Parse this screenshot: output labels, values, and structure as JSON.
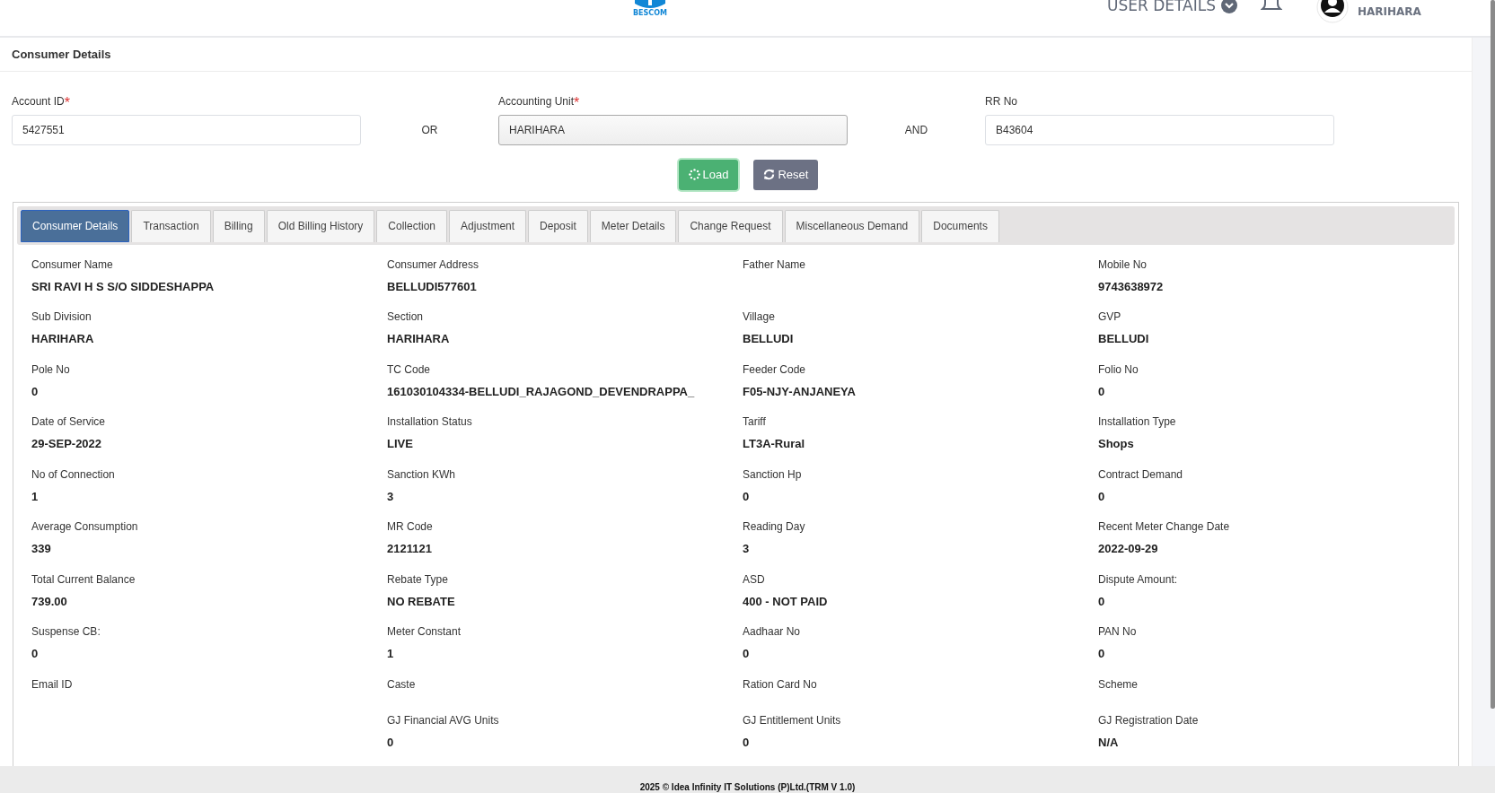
{
  "header": {
    "logo_text": "BESCOM",
    "user_menu": "USER DETAILS",
    "user_name": "HARIHARA"
  },
  "card_title": "Consumer Details",
  "search": [
    {
      "label": "Account ID",
      "required_mark": "*",
      "value": "5427551",
      "highlighted": false
    },
    {
      "label": "Accounting Unit",
      "required_mark": "*",
      "value": "HARIHARA",
      "highlighted": true
    },
    {
      "label": "RR No",
      "value": "B43604",
      "highlighted": false
    }
  ],
  "connectors": [
    "OR",
    "AND"
  ],
  "buttons": [
    {
      "label": "Load",
      "kind": "load"
    },
    {
      "label": "Reset",
      "kind": "reset"
    }
  ],
  "tabs": [
    {
      "label": "Consumer Details",
      "selected": true
    },
    {
      "label": "Transaction",
      "selected": false
    },
    {
      "label": "Billing",
      "selected": false
    },
    {
      "label": "Old Billing History",
      "selected": false
    },
    {
      "label": "Collection",
      "selected": false
    },
    {
      "label": "Adjustment",
      "selected": false
    },
    {
      "label": "Deposit",
      "selected": false
    },
    {
      "label": "Meter Details",
      "selected": false
    },
    {
      "label": "Change Request",
      "selected": false
    },
    {
      "label": "Miscellaneous Demand",
      "selected": false
    },
    {
      "label": "Documents",
      "selected": false
    }
  ],
  "details": [
    [
      {
        "label": "Consumer Name",
        "value": "SRI RAVI H S S/O SIDDESHAPPA"
      },
      {
        "label": "Consumer Address",
        "value": "BELLUDI577601"
      },
      {
        "label": "Father Name"
      },
      {
        "label": "Mobile No",
        "value": "9743638972"
      }
    ],
    [
      {
        "label": "Sub Division",
        "value": "HARIHARA"
      },
      {
        "label": "Section",
        "value": "HARIHARA"
      },
      {
        "label": "Village",
        "value": "BELLUDI"
      },
      {
        "label": "GVP",
        "value": "BELLUDI"
      }
    ],
    [
      {
        "label": "Pole No",
        "value": "0"
      },
      {
        "label": "TC Code",
        "value": "161030104334-BELLUDI_RAJAGOND_DEVENDRAPPA_"
      },
      {
        "label": "Feeder Code",
        "value": "F05-NJY-ANJANEYA"
      },
      {
        "label": "Folio No",
        "value": "0"
      }
    ],
    [
      {
        "label": "Date of Service",
        "value": "29-SEP-2022"
      },
      {
        "label": "Installation Status",
        "value": "LIVE"
      },
      {
        "label": "Tariff",
        "value": "LT3A-Rural"
      },
      {
        "label": "Installation Type",
        "value": "Shops"
      }
    ],
    [
      {
        "label": "No of Connection",
        "value": "1"
      },
      {
        "label": "Sanction KWh",
        "value": "3"
      },
      {
        "label": "Sanction Hp",
        "value": "0"
      },
      {
        "label": "Contract Demand",
        "value": "0"
      }
    ],
    [
      {
        "label": "Average Consumption",
        "value": "339"
      },
      {
        "label": "MR Code",
        "value": "2121121"
      },
      {
        "label": "Reading Day",
        "value": "3"
      },
      {
        "label": "Recent Meter Change Date",
        "value": "2022-09-29"
      }
    ],
    [
      {
        "label": "Total Current Balance",
        "value": "739.00"
      },
      {
        "label": "Rebate Type",
        "value": "NO REBATE"
      },
      {
        "label": "ASD",
        "value": "400 - NOT PAID"
      },
      {
        "label": "Dispute Amount:",
        "value": "0"
      }
    ],
    [
      {
        "label": "Suspense CB:",
        "value": "0"
      },
      {
        "label": "Meter Constant",
        "value": "1"
      },
      {
        "label": "Aadhaar No",
        "value": "0"
      },
      {
        "label": "PAN No",
        "value": "0"
      }
    ],
    [
      {
        "label": "Email ID"
      },
      {
        "label": "Caste"
      },
      {
        "label": "Ration Card No"
      },
      {
        "label": "Scheme"
      }
    ],
    [
      {
        "label": "GJ Financial AVG Units",
        "value": "0"
      },
      {
        "label": "GJ Entitlement Units",
        "value": "0"
      },
      {
        "label": "GJ Registration Date",
        "value": "N/A"
      }
    ]
  ],
  "footer": "2025 © Idea Infinity IT Solutions (P)Ltd.(TRM V 1.0)"
}
